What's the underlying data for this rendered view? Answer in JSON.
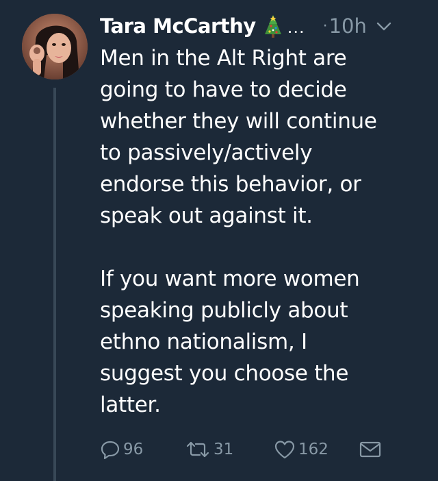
{
  "tweet": {
    "author_name": "Tara McCarthy",
    "ellipsis": "...",
    "separator": "·",
    "timestamp": "10h",
    "body_lines_p1": [
      "Men in the Alt Right are",
      "going to have to decide",
      "whether they will continue",
      "to passively/actively",
      "endorse this behavior, or",
      "speak out against it."
    ],
    "body_lines_p2": [
      "If you want more women",
      "speaking publicly about",
      "ethno nationalism, I",
      "suggest you choose the",
      "latter."
    ],
    "actions": {
      "reply_count": "96",
      "retweet_count": "31",
      "like_count": "162"
    }
  },
  "icons": {
    "avatar": "avatar-photo",
    "name_emoji": "christmas-tree-icon",
    "caret": "chevron-down-icon",
    "reply": "reply-icon",
    "retweet": "retweet-icon",
    "like": "heart-icon",
    "dm": "envelope-icon"
  },
  "colors": {
    "background": "#1c2938",
    "text_primary": "#ffffff",
    "text_secondary": "#8899a6",
    "thread_line": "#384857"
  }
}
